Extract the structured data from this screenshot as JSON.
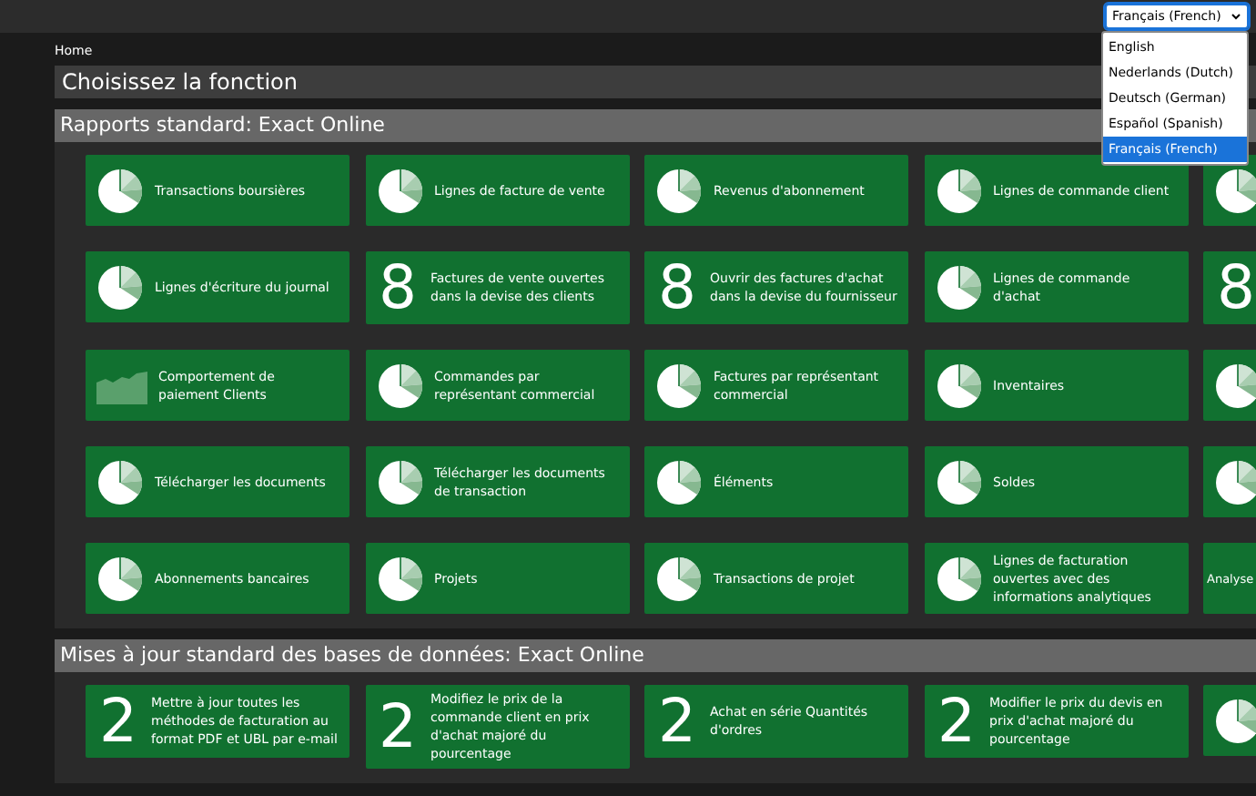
{
  "top_bar": {
    "language_select": {
      "value": "Français (French)",
      "expanded": true,
      "options": [
        {
          "label": "English",
          "selected": false
        },
        {
          "label": "Nederlands (Dutch)",
          "selected": false
        },
        {
          "label": "Deutsch (German)",
          "selected": false
        },
        {
          "label": "Español (Spanish)",
          "selected": false
        },
        {
          "label": "Français (French)",
          "selected": true
        }
      ]
    }
  },
  "breadcrumb": "Home",
  "panel": {
    "title": "Choisissez la fonction",
    "sections": [
      {
        "title": "Rapports standard: Exact Online",
        "tiles": [
          {
            "kind": "pie",
            "label": "Transactions boursières"
          },
          {
            "kind": "pie",
            "label": "Lignes de facture de vente"
          },
          {
            "kind": "pie",
            "label": "Revenus d'abonnement"
          },
          {
            "kind": "pie",
            "label": "Lignes de commande client"
          },
          {
            "kind": "pie"
          },
          {
            "kind": "pie",
            "label": "Lignes d'écriture du journal"
          },
          {
            "kind": "number",
            "number": "8",
            "label": "Factures de vente ouvertes dans la devise des clients"
          },
          {
            "kind": "number",
            "number": "8",
            "label": "Ouvrir des factures d'achat dans la devise du fournisseur"
          },
          {
            "kind": "pie",
            "label": "Lignes de commande d'achat"
          },
          {
            "kind": "number",
            "number": "8"
          },
          {
            "kind": "area",
            "label": "Comportement de paiement Clients"
          },
          {
            "kind": "pie",
            "label": "Commandes par représentant commercial"
          },
          {
            "kind": "pie",
            "label": "Factures par représentant commercial"
          },
          {
            "kind": "pie",
            "label": "Inventaires"
          },
          {
            "kind": "pie"
          },
          {
            "kind": "pie",
            "label": "Télécharger les documents"
          },
          {
            "kind": "pie",
            "label": "Télécharger les documents de transaction"
          },
          {
            "kind": "pie",
            "label": "Éléments"
          },
          {
            "kind": "pie",
            "label": "Soldes"
          },
          {
            "kind": "pie"
          },
          {
            "kind": "pie",
            "label": "Abonnements bancaires"
          },
          {
            "kind": "pie",
            "label": "Projets"
          },
          {
            "kind": "pie",
            "label": "Transactions de projet"
          },
          {
            "kind": "pie",
            "label": "Lignes de facturation ouvertes avec des informations analytiques"
          },
          {
            "kind": "text",
            "label": "Analyse"
          }
        ]
      },
      {
        "title": "Mises à jour standard des bases de données: Exact Online",
        "tiles": [
          {
            "kind": "number",
            "number": "2",
            "label": "Mettre à jour toutes les méthodes de facturation au format PDF et UBL par e-mail"
          },
          {
            "kind": "number",
            "number": "2",
            "label": "Modifiez le prix de la commande client en prix d'achat majoré du pourcentage"
          },
          {
            "kind": "number",
            "number": "2",
            "label": "Achat en série Quantités d'ordres"
          },
          {
            "kind": "number",
            "number": "2",
            "label": "Modifier le prix du devis en prix d'achat majoré du pourcentage"
          },
          {
            "kind": "pie"
          }
        ]
      }
    ]
  }
}
